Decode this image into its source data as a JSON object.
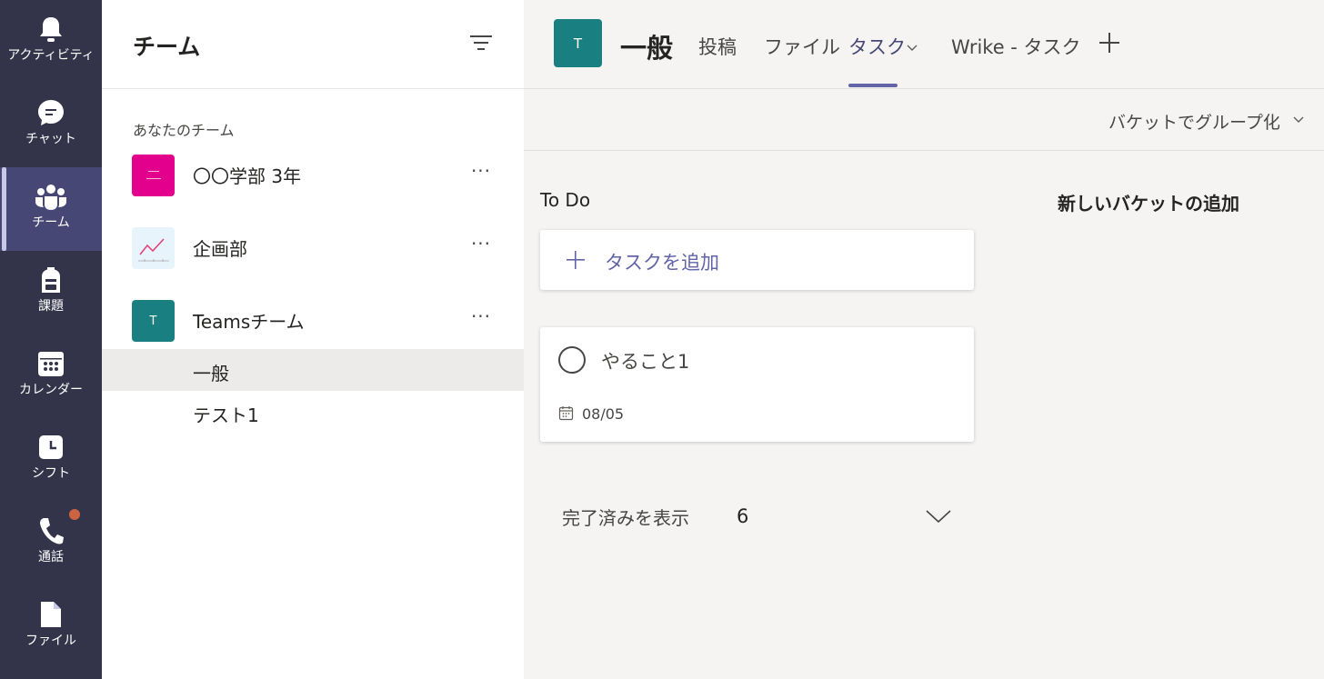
{
  "rail": {
    "items": [
      {
        "label": "アクティビティ",
        "icon": "bell-icon"
      },
      {
        "label": "チャット",
        "icon": "chat-icon"
      },
      {
        "label": "チーム",
        "icon": "teams-icon"
      },
      {
        "label": "課題",
        "icon": "backpack-icon"
      },
      {
        "label": "カレンダー",
        "icon": "calendar-icon"
      },
      {
        "label": "シフト",
        "icon": "clock-icon"
      },
      {
        "label": "通話",
        "icon": "phone-icon"
      },
      {
        "label": "ファイル",
        "icon": "file-icon"
      }
    ],
    "active": "チーム",
    "notification_color": "#cc6442"
  },
  "teams_pane": {
    "title": "チーム",
    "section_label": "あなたのチーム",
    "teams": [
      {
        "name": "〇〇学部 3年",
        "avatar_color": "#e3008c",
        "more": "···"
      },
      {
        "name": "企画部",
        "avatar_color": "#e8f4fb",
        "more": "···"
      },
      {
        "name": "Teamsチーム",
        "avatar_color": "#1a7f80",
        "avatar_letter": "T",
        "more": "···"
      }
    ],
    "channels": [
      {
        "name": "一般",
        "selected": true
      },
      {
        "name": "テスト1",
        "selected": false
      }
    ]
  },
  "header": {
    "avatar_letter": "T",
    "channel_title": "一般",
    "tabs": [
      {
        "label": "投稿"
      },
      {
        "label": "ファイル"
      },
      {
        "label": "タスク",
        "active": true
      },
      {
        "label": "Wrike - タスク"
      }
    ]
  },
  "toolbar": {
    "group_by": "バケットでグループ化"
  },
  "board": {
    "bucket_title": "To Do",
    "new_bucket": "新しいバケットの追加",
    "add_task_label": "タスクを追加",
    "task": {
      "title": "やること1",
      "due": "08/05"
    },
    "show_completed_label": "完了済みを表示",
    "completed_count": "6"
  },
  "colors": {
    "rail_bg": "#33344a",
    "accent": "#6264a7",
    "team_teal": "#1a7f80",
    "team_pink": "#e3008c"
  }
}
